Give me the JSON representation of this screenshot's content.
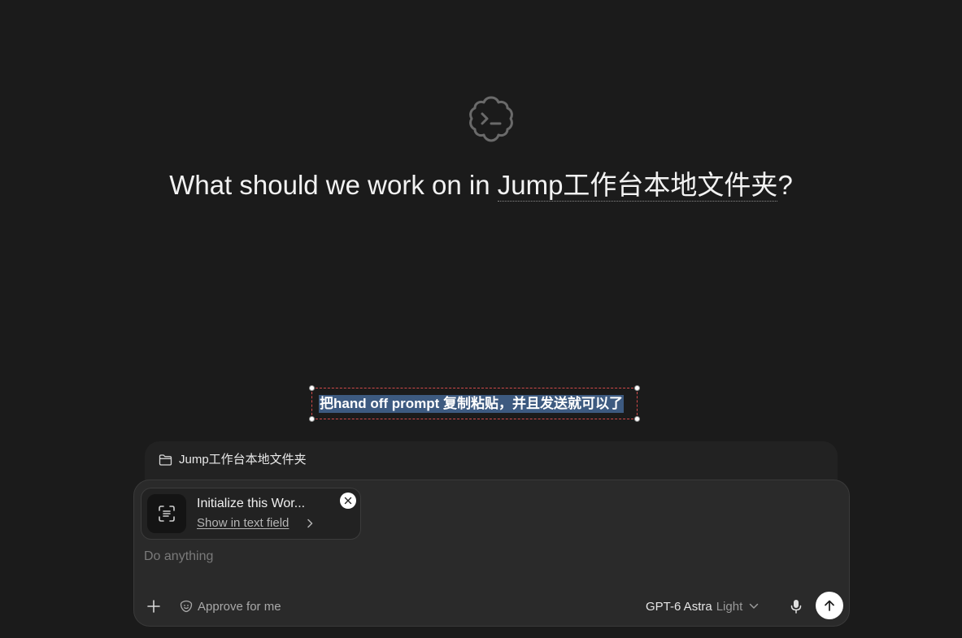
{
  "headline": {
    "prefix": "What should we work on in ",
    "workspace": "Jump工作台本地文件夹",
    "suffix": "?"
  },
  "selection": {
    "text": "把hand off prompt 复制粘贴，并且发送就可以了"
  },
  "workspace_bar": {
    "label": "Jump工作台本地文件夹",
    "icon": "folder-icon"
  },
  "attachment": {
    "title": "Initialize this Wor...",
    "link": "Show in text field",
    "icon": "scan-text-icon"
  },
  "composer": {
    "placeholder": "Do anything",
    "approve_label": "Approve for me",
    "model_name": "GPT-6 Astra",
    "model_mode": "Light"
  },
  "colors": {
    "background": "#1b1b1b",
    "composer": "#2a2a2a",
    "selection_highlight": "#3d5a80",
    "selection_border": "#d24a4a"
  }
}
